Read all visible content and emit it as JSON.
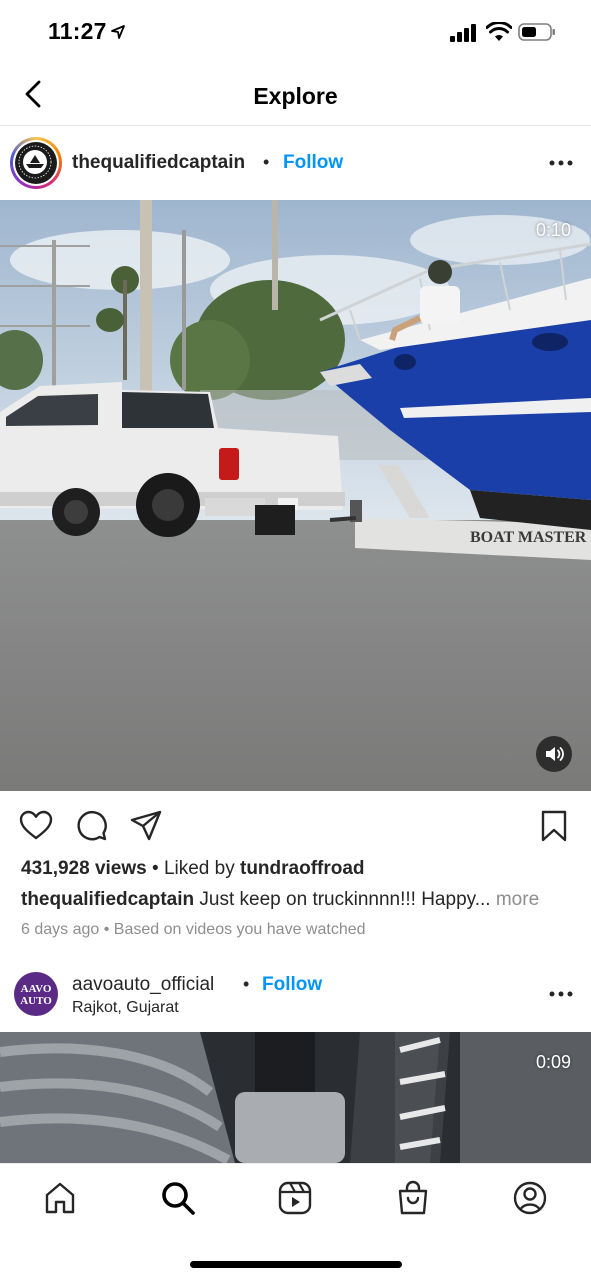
{
  "status_bar": {
    "time": "11:27"
  },
  "header": {
    "title": "Explore"
  },
  "posts": [
    {
      "username": "thequalifiedcaptain",
      "follow_label": "Follow",
      "avatar_text": "THE QUALIFIED CAPTAIN",
      "duration": "0:10",
      "views": "431,928 views",
      "liked_by_prefix": "Liked by",
      "liked_by_user": "tundraoffroad",
      "caption_user": "thequalifiedcaptain",
      "caption_text": "Just keep on truckinnnn!!! Happy...",
      "more_label": "more",
      "age": "6 days ago",
      "reason": "Based on videos you have watched",
      "media_texts": {
        "trailer_brand": "BOAT MASTER"
      }
    },
    {
      "username": "aavoauto_official",
      "follow_label": "Follow",
      "location": "Rajkot, Gujarat",
      "avatar_text": "AAVO AUTO",
      "duration": "0:09"
    }
  ],
  "icons": {
    "back": "chevron-left-icon",
    "more": "more-horizontal-icon",
    "like": "heart-icon",
    "comment": "comment-icon",
    "share": "send-icon",
    "save": "bookmark-icon",
    "mute": "speaker-icon",
    "tabs": [
      "home-icon",
      "search-icon",
      "reels-icon",
      "shop-icon",
      "profile-icon"
    ]
  },
  "colors": {
    "link": "#0095f6",
    "text": "#262626",
    "muted": "#8e8e8e",
    "boat_blue": "#1b3fa8"
  }
}
